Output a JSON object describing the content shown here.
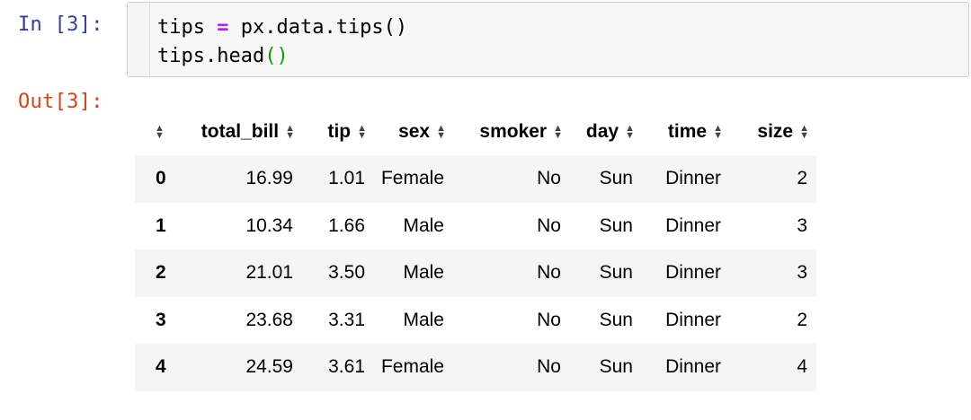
{
  "input_cell": {
    "prompt": "In [3]:",
    "line1": {
      "a": "tips ",
      "op": "=",
      "b": " px.data.tips()"
    },
    "line2": {
      "a": "tips.head",
      "paren": "()"
    }
  },
  "output_cell": {
    "prompt": "Out[3]:"
  },
  "dataframe": {
    "columns": [
      "total_bill",
      "tip",
      "sex",
      "smoker",
      "day",
      "time",
      "size"
    ],
    "rows": [
      {
        "index": "0",
        "values": [
          "16.99",
          "1.01",
          "Female",
          "No",
          "Sun",
          "Dinner",
          "2"
        ]
      },
      {
        "index": "1",
        "values": [
          "10.34",
          "1.66",
          "Male",
          "No",
          "Sun",
          "Dinner",
          "3"
        ]
      },
      {
        "index": "2",
        "values": [
          "21.01",
          "3.50",
          "Male",
          "No",
          "Sun",
          "Dinner",
          "3"
        ]
      },
      {
        "index": "3",
        "values": [
          "23.68",
          "3.31",
          "Male",
          "No",
          "Sun",
          "Dinner",
          "2"
        ]
      },
      {
        "index": "4",
        "values": [
          "24.59",
          "3.61",
          "Female",
          "No",
          "Sun",
          "Dinner",
          "4"
        ]
      }
    ]
  }
}
